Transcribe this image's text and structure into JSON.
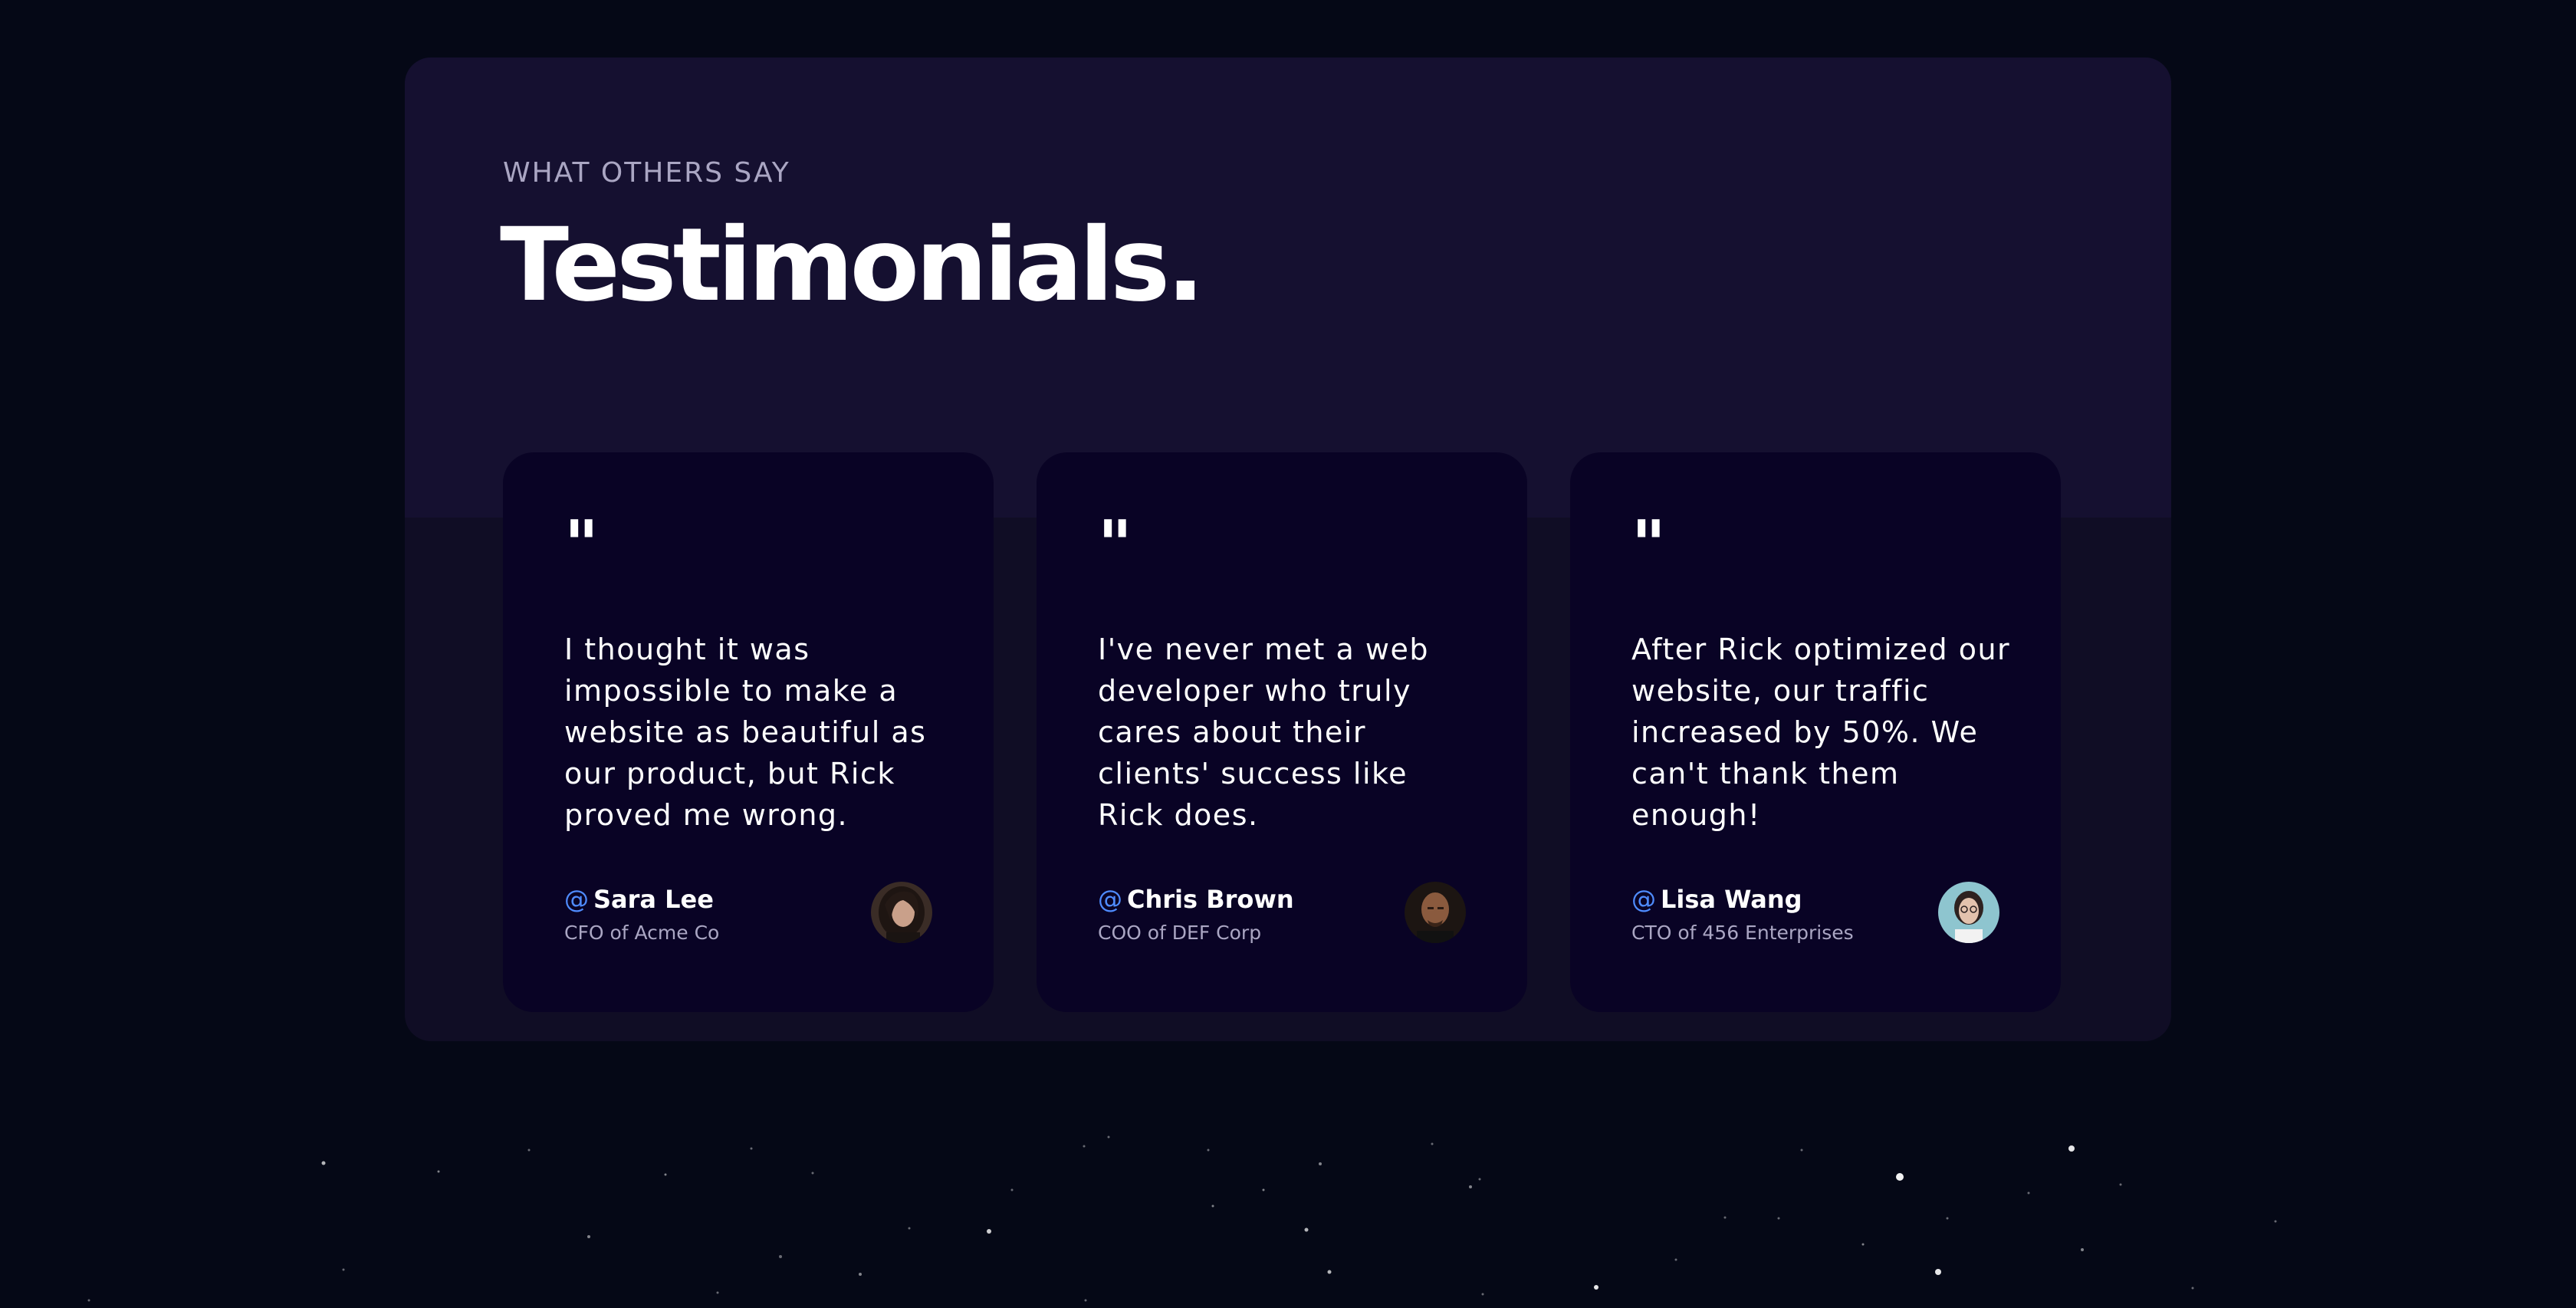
{
  "section": {
    "eyebrow": "WHAT OTHERS SAY",
    "title": "Testimonials."
  },
  "testimonials": [
    {
      "quote_mark": "\"",
      "text": "I thought it was impossible to make a website as beautiful as our product, but Rick proved me wrong.",
      "at": "@",
      "name": "Sara Lee",
      "role": "CFO of Acme Co",
      "avatar_icon": "avatar-photo"
    },
    {
      "quote_mark": "\"",
      "text": "I've never met a web developer who truly cares about their clients' success like Rick does.",
      "at": "@",
      "name": "Chris Brown",
      "role": "COO of DEF Corp",
      "avatar_icon": "avatar-photo"
    },
    {
      "quote_mark": "\"",
      "text": "After Rick optimized our website, our traffic increased by 50%. We can't thank them enough!",
      "at": "@",
      "name": "Lisa Wang",
      "role": "CTO of 456 Enterprises",
      "avatar_icon": "avatar-photo"
    }
  ],
  "colors": {
    "background": "#050816",
    "panel": "#100d25",
    "panel_top": "#151030",
    "card": "#090325",
    "accent_at": "#4f8cff",
    "secondary_text": "#aaa6c3"
  }
}
